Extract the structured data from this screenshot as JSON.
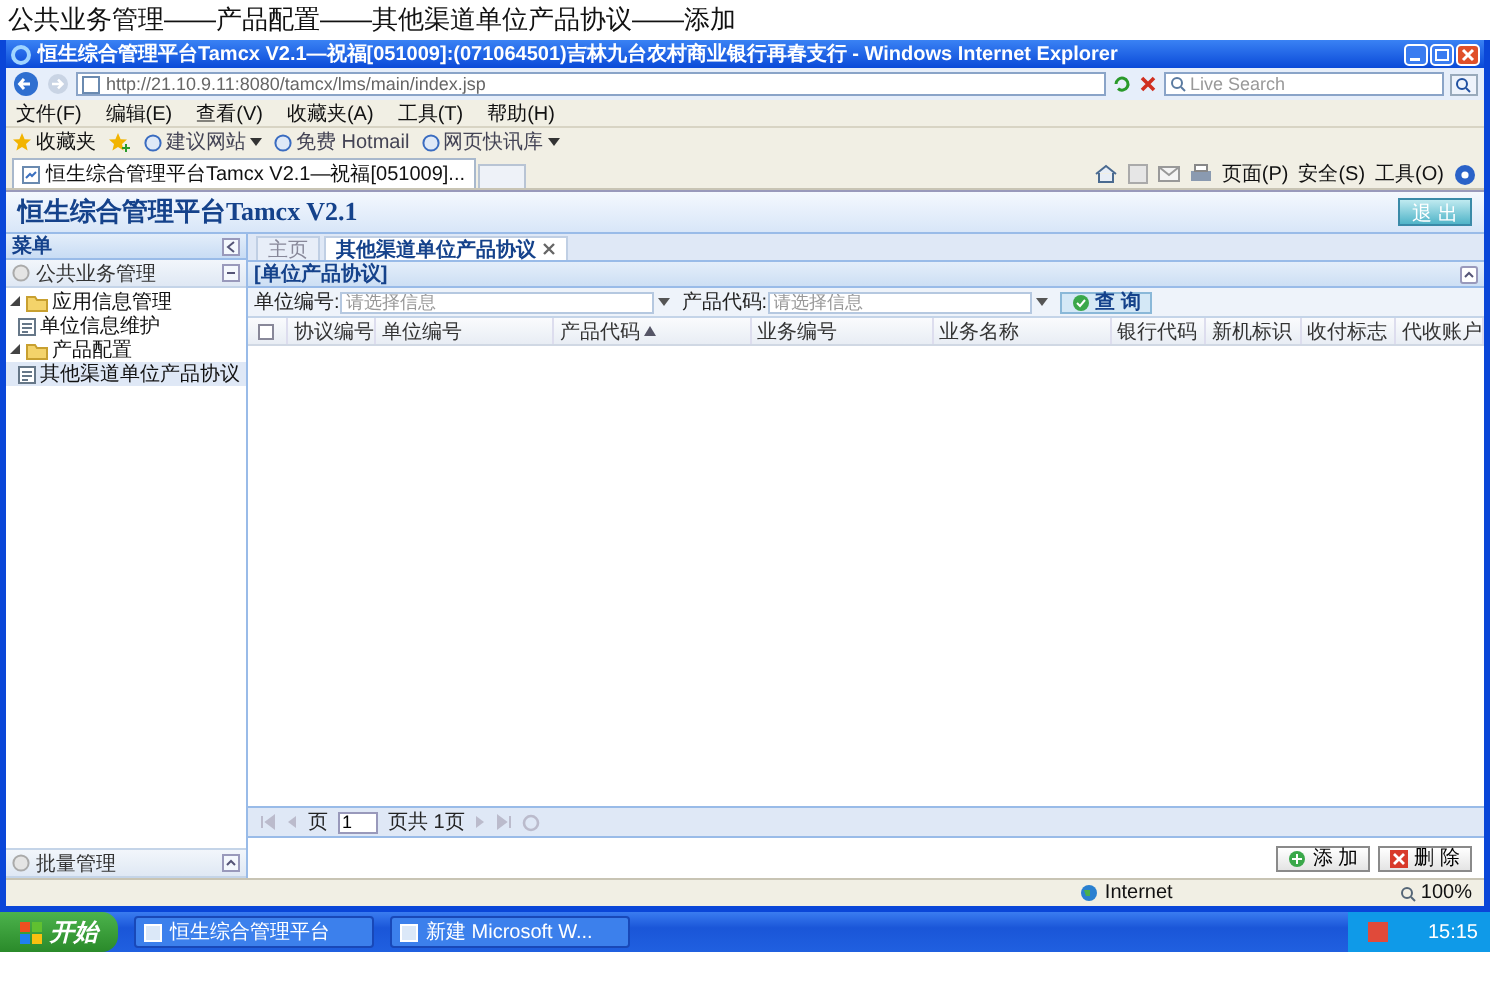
{
  "caption": "公共业务管理——产品配置——其他渠道单位产品协议——添加",
  "window": {
    "title": "恒生综合管理平台Tamcx V2.1—祝福[051009]:(071064501)吉林九台农村商业银行再春支行 - Windows Internet Explorer",
    "address": "http://21.10.9.11:8080/tamcx/lms/main/index.jsp",
    "search_placeholder": "Live Search"
  },
  "menu_bar": [
    "文件(F)",
    "编辑(E)",
    "查看(V)",
    "收藏夹(A)",
    "工具(T)",
    "帮助(H)"
  ],
  "favorites_bar": {
    "label": "收藏夹",
    "links": [
      {
        "label": "建议网站",
        "dropdown": true
      },
      {
        "label": "免费 Hotmail",
        "dropdown": false
      },
      {
        "label": "网页快讯库",
        "dropdown": true
      }
    ]
  },
  "browser_tabs": [
    {
      "label": "恒生综合管理平台Tamcx V2.1—祝福[051009]...",
      "selected": true
    }
  ],
  "command_bar": [
    "页面(P)",
    "安全(S)",
    "工具(O)"
  ],
  "app": {
    "title": "恒生综合管理平台Tamcx V2.1",
    "logout": "退 出"
  },
  "sidebar": {
    "title": "菜单",
    "sections": [
      {
        "label": "公共业务管理",
        "expanded": true,
        "children": [
          {
            "label": "应用信息管理",
            "expanded": true,
            "children": [
              {
                "label": "单位信息维护",
                "selected": false
              }
            ]
          },
          {
            "label": "产品配置",
            "expanded": true,
            "children": [
              {
                "label": "其他渠道单位产品协议",
                "selected": true
              }
            ]
          }
        ]
      },
      {
        "label": "批量管理",
        "expanded": false
      }
    ]
  },
  "page_tabs": [
    {
      "label": "主页",
      "selected": false,
      "closable": false
    },
    {
      "label": "其他渠道单位产品协议",
      "selected": true,
      "closable": true
    }
  ],
  "panel": {
    "title": "[单位产品协议]",
    "filters": [
      {
        "label": "单位编号:",
        "placeholder": "请选择信息"
      },
      {
        "label": "产品代码:",
        "placeholder": "请选择信息"
      }
    ],
    "search_button": "查 询"
  },
  "table": {
    "select_all": {
      "checked": false
    },
    "columns": [
      {
        "label": "协议编号",
        "sorted": false
      },
      {
        "label": "单位编号",
        "sorted": false
      },
      {
        "label": "产品代码",
        "sorted": true
      },
      {
        "label": "业务编号",
        "sorted": false
      },
      {
        "label": "业务名称",
        "sorted": false
      },
      {
        "label": "银行代码",
        "sorted": false
      },
      {
        "label": "新机标识",
        "sorted": false
      },
      {
        "label": "收付标志",
        "sorted": false
      },
      {
        "label": "代收账户",
        "sorted": false
      }
    ]
  },
  "pager": {
    "page_label": "页",
    "page": "1",
    "total": "页共 1页"
  },
  "actions": [
    {
      "label": "添 加",
      "kind": "add"
    },
    {
      "label": "删 除",
      "kind": "delete"
    }
  ],
  "status_bar": {
    "zone": "Internet",
    "zoom": "100%"
  },
  "taskbar": {
    "start": "开始",
    "items": [
      "恒生综合管理平台",
      "新建 Microsoft W..."
    ],
    "clock": "15:15"
  }
}
